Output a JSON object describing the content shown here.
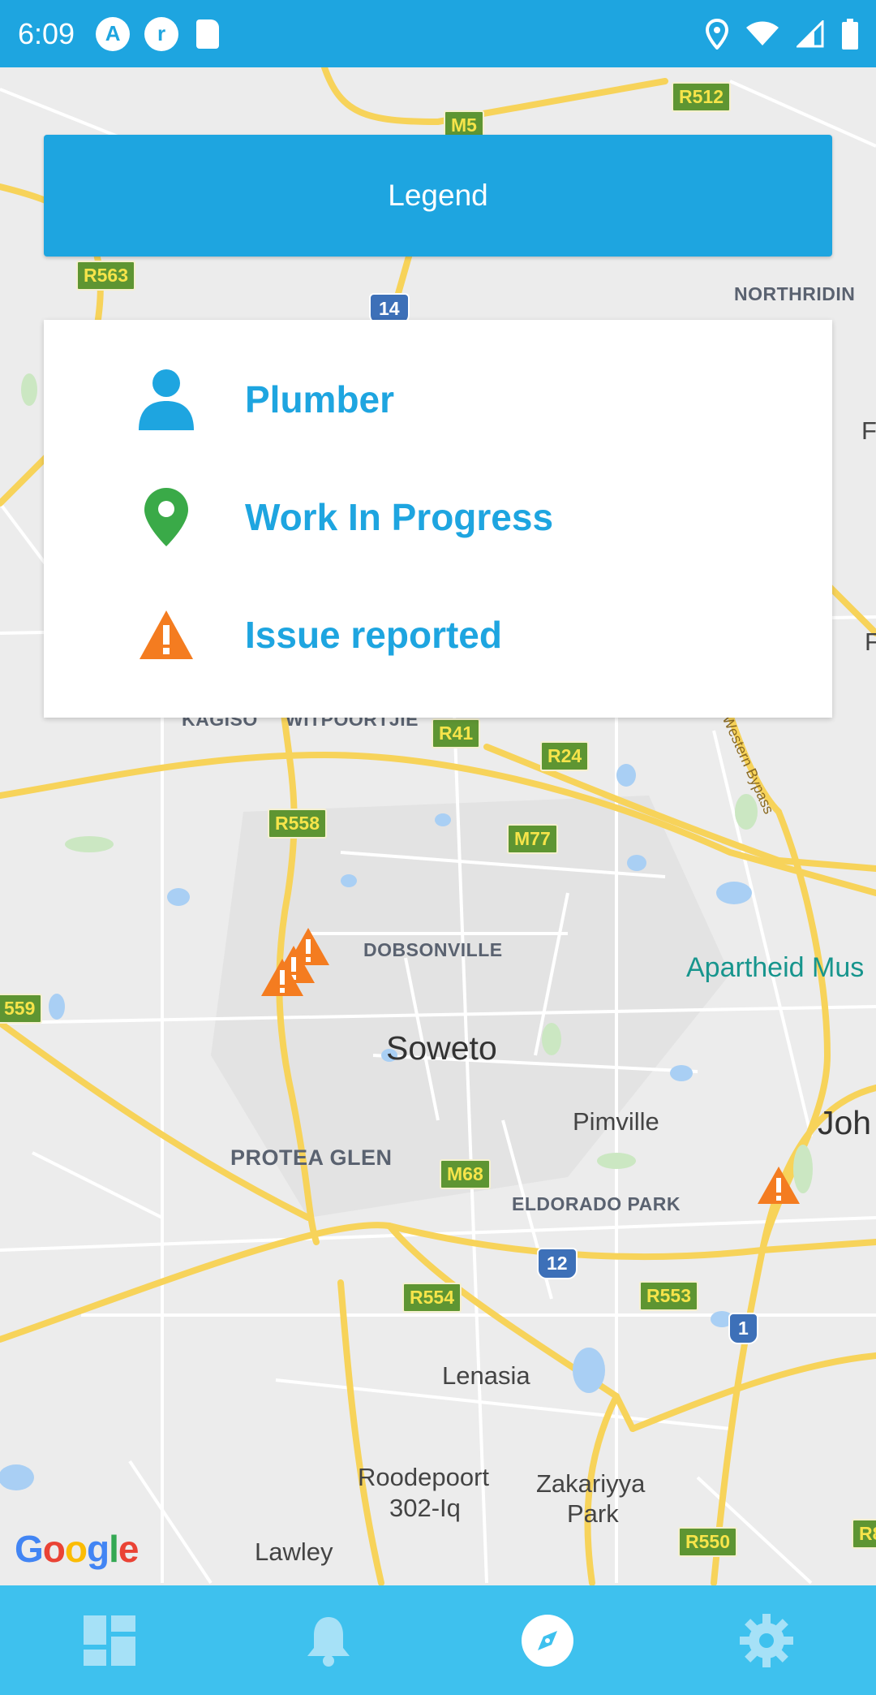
{
  "status_bar": {
    "time": "6:09",
    "app_icon_letter": "A",
    "app_icon2_letter": "r"
  },
  "map": {
    "places": {
      "northriding": "NORTHRIDIN",
      "kagiso": "KAGISO",
      "witpoortjie": "WITPOORTJIE",
      "dobsonville": "DOBSONVILLE",
      "soweto": "Soweto",
      "pimville": "Pimville",
      "protea_glen": "PROTEA GLEN",
      "eldorado_park": "ELDORADO PARK",
      "lenasia": "Lenasia",
      "roodepoort_line1": "Roodepoort",
      "roodepoort_line2": "302-Iq",
      "zakariyya_line1": "Zakariyya",
      "zakariyya_line2": "Park",
      "lawley": "Lawley",
      "johannesburg_partial": "Joh",
      "apartheid_museum": "Apartheid Mus",
      "edge_f": "F",
      "edge_r": "F",
      "western_bypass": "Western Bypass"
    },
    "shields": {
      "r512": "R512",
      "m5": "M5",
      "r563": "R563",
      "n14": "14",
      "r41": "R41",
      "r24": "R24",
      "r558": "R558",
      "m77": "M77",
      "r559_partial": "559",
      "m68": "M68",
      "n12": "12",
      "r554": "R554",
      "r553": "R553",
      "n1": "1",
      "r550": "R550",
      "r8_partial": "R8"
    },
    "attribution": [
      "G",
      "o",
      "o",
      "g",
      "l",
      "e"
    ]
  },
  "legend": {
    "button_label": "Legend",
    "items": [
      {
        "label": "Plumber",
        "icon": "person-icon",
        "color": "#1ea5e0"
      },
      {
        "label": "Work In Progress",
        "icon": "map-pin-icon",
        "color": "#3aaa48"
      },
      {
        "label": "Issue reported",
        "icon": "warning-icon",
        "color": "#f47c20"
      }
    ]
  },
  "bottom_nav": {
    "items": [
      {
        "icon": "dashboard-icon"
      },
      {
        "icon": "bell-icon"
      },
      {
        "icon": "compass-icon",
        "active": true
      },
      {
        "icon": "gear-icon"
      }
    ]
  },
  "colors": {
    "primary": "#1ea5e0",
    "nav": "#3ec1ee",
    "issue": "#f47c20",
    "progress": "#3aaa48"
  }
}
